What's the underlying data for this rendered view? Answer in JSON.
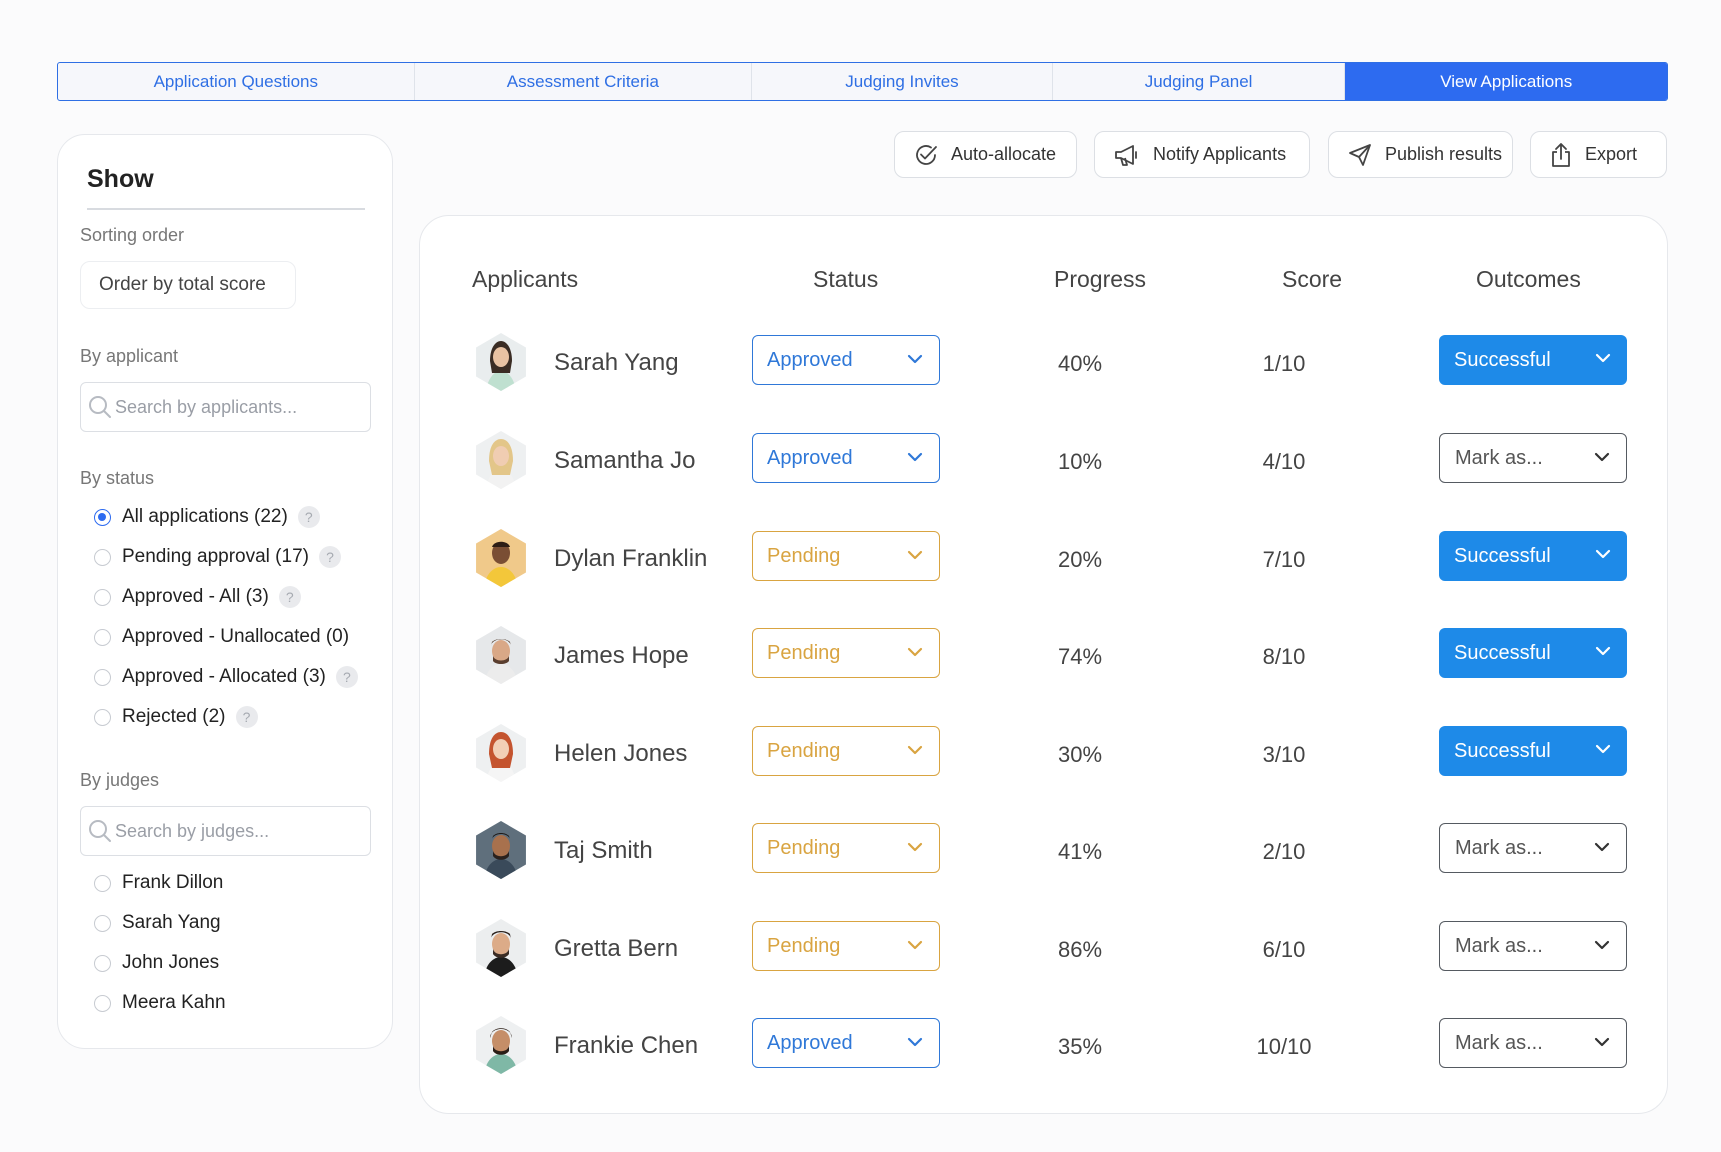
{
  "tabs": [
    {
      "label": "Application Questions"
    },
    {
      "label": "Assessment Criteria"
    },
    {
      "label": "Judging Invites"
    },
    {
      "label": "Judging Panel"
    },
    {
      "label": "View Applications"
    }
  ],
  "sidebar": {
    "title": "Show",
    "sorting_label": "Sorting order",
    "sorting_value": "Order by total score",
    "applicant_label": "By applicant",
    "applicant_search_placeholder": "Search by applicants...",
    "status_label": "By status",
    "status_options": [
      {
        "label": "All applications (22)"
      },
      {
        "label": "Pending approval (17)"
      },
      {
        "label": "Approved - All (3)"
      },
      {
        "label": "Approved - Unallocated (0)"
      },
      {
        "label": "Approved - Allocated (3)"
      },
      {
        "label": "Rejected (2)"
      }
    ],
    "help_glyph": "?",
    "judges_label": "By judges",
    "judges_search_placeholder": "Search by judges...",
    "judges": [
      {
        "label": "Frank Dillon"
      },
      {
        "label": "Sarah Yang"
      },
      {
        "label": "John Jones"
      },
      {
        "label": "Meera Kahn"
      }
    ]
  },
  "actions": {
    "auto_allocate": "Auto-allocate",
    "notify": "Notify Applicants",
    "publish": "Publish results",
    "export": "Export"
  },
  "table": {
    "headers": {
      "applicants": "Applicants",
      "status": "Status",
      "progress": "Progress",
      "score": "Score",
      "outcomes": "Outcomes"
    },
    "rows": [
      {
        "name": "Sarah Yang",
        "status": "Approved",
        "progress": "40%",
        "score": "1/10",
        "outcome": "Successful"
      },
      {
        "name": "Samantha Jo",
        "status": "Approved",
        "progress": "10%",
        "score": "4/10",
        "outcome": "Mark as..."
      },
      {
        "name": "Dylan Franklin",
        "status": "Pending",
        "progress": "20%",
        "score": "7/10",
        "outcome": "Successful"
      },
      {
        "name": "James Hope",
        "status": "Pending",
        "progress": "74%",
        "score": "8/10",
        "outcome": "Successful"
      },
      {
        "name": "Helen Jones",
        "status": "Pending",
        "progress": "30%",
        "score": "3/10",
        "outcome": "Successful"
      },
      {
        "name": "Taj Smith",
        "status": "Pending",
        "progress": "41%",
        "score": "2/10",
        "outcome": "Mark as..."
      },
      {
        "name": "Gretta Bern",
        "status": "Pending",
        "progress": "86%",
        "score": "6/10",
        "outcome": "Mark as..."
      },
      {
        "name": "Frankie Chen",
        "status": "Approved",
        "progress": "35%",
        "score": "10/10",
        "outcome": "Mark as..."
      }
    ]
  },
  "colors": {
    "accent": "#2d6bf0",
    "approved": "#2f78d8",
    "pending": "#d9a441",
    "successful": "#1e8ae8"
  }
}
